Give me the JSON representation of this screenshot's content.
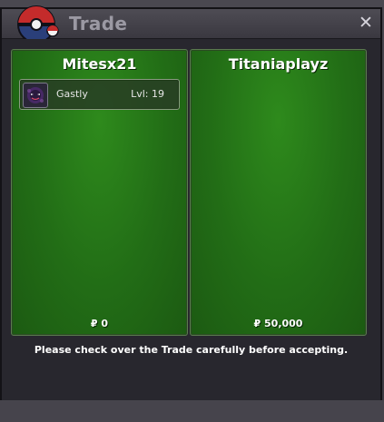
{
  "window": {
    "title": "Trade",
    "close_glyph": "✕",
    "logo_icon": "pokeball-logo-icon",
    "close_icon": "close-icon"
  },
  "panels": [
    {
      "player": "Mitesx21",
      "money": "₽ 0",
      "items": [
        {
          "name": "Gastly",
          "level": "Lvl: 19",
          "icon": "gastly-icon"
        }
      ]
    },
    {
      "player": "Titaniaplayz",
      "money": "₽ 50,000",
      "items": []
    }
  ],
  "notice": "Please check over the Trade carefully before accepting.",
  "colors": {
    "panel_green": "#226d16",
    "window_bg": "#28272e",
    "title_text": "#9b99a3"
  }
}
